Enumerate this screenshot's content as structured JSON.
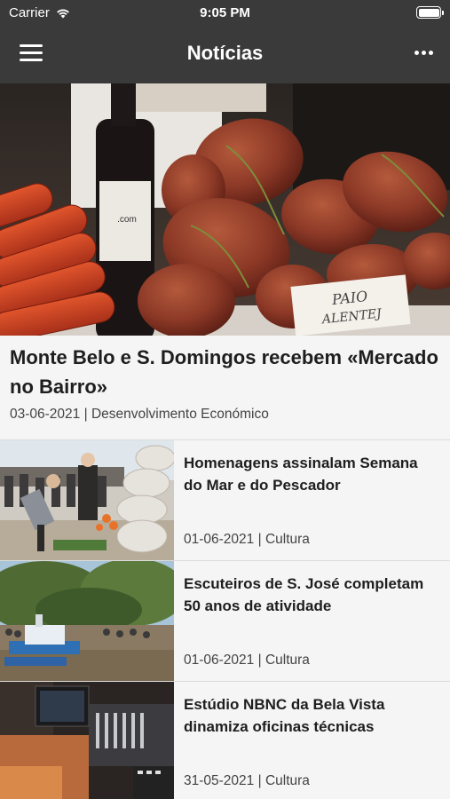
{
  "status_bar": {
    "carrier": "Carrier",
    "time": "9:05 PM"
  },
  "nav": {
    "title": "Notícias"
  },
  "featured": {
    "title": "Monte Belo e S. Domingos recebem «Mercado no Bairro»",
    "date": "03-06-2021",
    "category": "Desenvolvimento Económico",
    "image_sign_text": "PAIO ALENTEJ"
  },
  "items": [
    {
      "title": "Homenagens assinalam Semana do Mar e do Pescador",
      "date": "01-06-2021",
      "category": "Cultura"
    },
    {
      "title": "Escuteiros de S. José completam 50 anos de atividade",
      "date": "01-06-2021",
      "category": "Cultura"
    },
    {
      "title": "Estúdio NBNC da Bela Vista dinamiza oficinas técnicas",
      "date": "31-05-2021",
      "category": "Cultura"
    }
  ],
  "separator": " | ",
  "colors": {
    "bar": "#3a3a3a",
    "background": "#f5f5f5",
    "divider": "#dcdcdc"
  }
}
